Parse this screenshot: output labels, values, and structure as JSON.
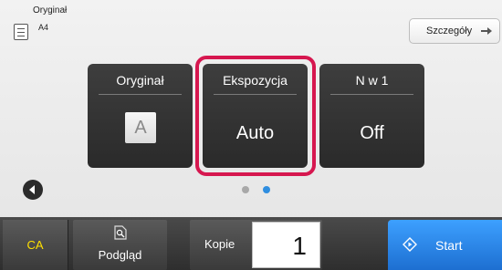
{
  "header": {
    "original_label": "Oryginał",
    "original_size": "A4",
    "details_label": "Szczegóły"
  },
  "tiles": [
    {
      "title": "Oryginał",
      "value": "A"
    },
    {
      "title": "Ekspozycja",
      "value": "Auto",
      "selected": true
    },
    {
      "title": "N w 1",
      "value": "Off"
    }
  ],
  "pager": {
    "pages": 2,
    "current_page": 2
  },
  "bottom": {
    "ca_label": "CA",
    "preview_label": "Podgląd",
    "copies_label": "Kopie",
    "copies_value": "1",
    "start_label": "Start"
  },
  "colors": {
    "highlight": "#d6174f",
    "ca_text": "#ffe000",
    "start": "#2f8ee0",
    "active_dot": "#2f8ee0"
  },
  "icons": [
    "document-icon",
    "arrow-right-icon",
    "chevron-left-icon",
    "preview-icon",
    "start-icon"
  ]
}
